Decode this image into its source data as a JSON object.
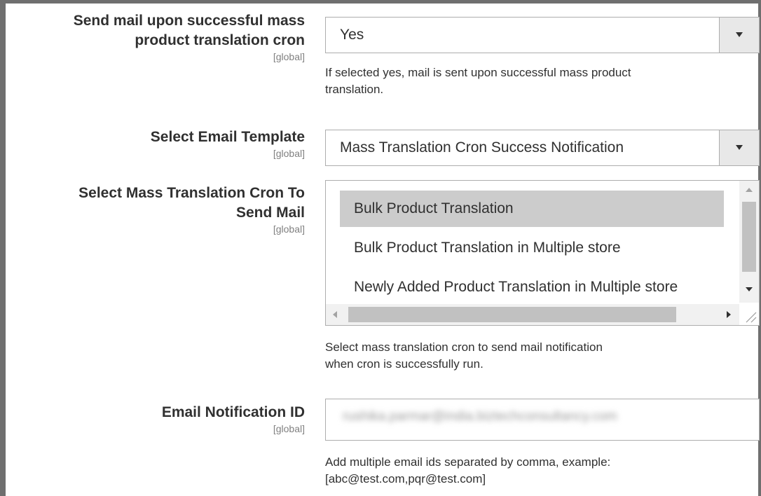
{
  "fields": {
    "send_mail": {
      "label_line1": "Send mail upon successful mass",
      "label_line2": "product translation cron",
      "scope": "[global]",
      "value": "Yes",
      "note_line1": "If selected yes, mail is sent upon successful mass product",
      "note_line2": "translation."
    },
    "email_template": {
      "label": "Select Email Template",
      "scope": "[global]",
      "value": "Mass Translation Cron Success Notification"
    },
    "cron_select": {
      "label_line1": "Select Mass Translation Cron To",
      "label_line2": "Send Mail",
      "scope": "[global]",
      "options": [
        {
          "label": "Bulk Product Translation",
          "selected": true
        },
        {
          "label": "Bulk Product Translation in Multiple store",
          "selected": false
        },
        {
          "label": "Newly Added Product Translation in Multiple store",
          "selected": false
        }
      ],
      "note_line1": "Select mass translation cron to send mail notification",
      "note_line2": "when cron is successfully run."
    },
    "email_id": {
      "label": "Email Notification ID",
      "scope": "[global]",
      "value": "rushika.parmar@india.biztechconsultancy.com",
      "note_line1": "Add multiple email ids separated by comma, example:",
      "note_line2": "[abc@test.com,pqr@test.com]"
    }
  },
  "icons": {
    "dropdown": "chevron-down-icon",
    "scroll_up": "scroll-up-arrow-icon",
    "scroll_down": "scroll-down-arrow-icon",
    "scroll_left": "scroll-left-arrow-icon",
    "scroll_right": "scroll-right-arrow-icon",
    "resize": "resize-grip-icon"
  },
  "colors": {
    "selected_option_bg": "#cccccc",
    "border": "#adadad",
    "scope_text": "#808080"
  }
}
